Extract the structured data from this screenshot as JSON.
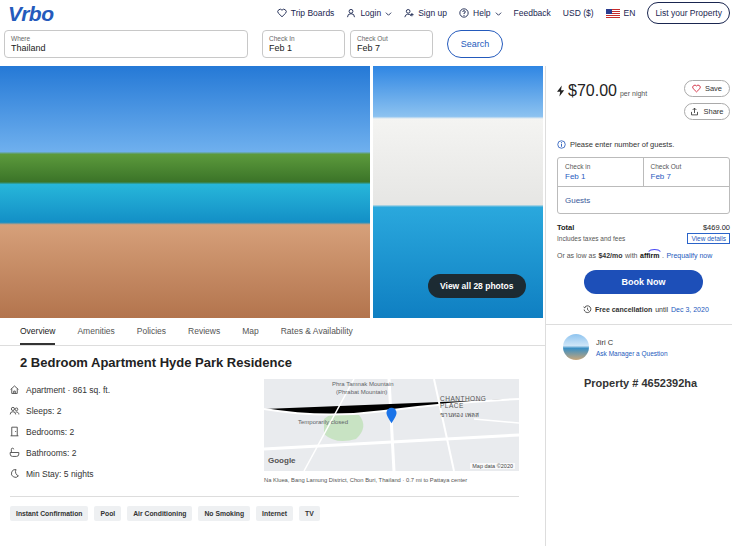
{
  "header": {
    "logo": "Vrbo",
    "nav": {
      "trip_boards": "Trip Boards",
      "login": "Login",
      "signup": "Sign up",
      "help": "Help",
      "feedback": "Feedback",
      "currency": "USD ($)",
      "language": "EN",
      "list_property": "List your Property"
    }
  },
  "search": {
    "where": {
      "label": "Where",
      "value": "Thailand"
    },
    "check_in": {
      "label": "Check In",
      "value": "Feb 1"
    },
    "check_out": {
      "label": "Check Out",
      "value": "Feb 7"
    },
    "button": "Search"
  },
  "gallery": {
    "button": "View all 28 photos"
  },
  "tabs": [
    {
      "label": "Overview",
      "selected": true
    },
    {
      "label": "Amenities",
      "selected": false
    },
    {
      "label": "Policies",
      "selected": false
    },
    {
      "label": "Reviews",
      "selected": false
    },
    {
      "label": "Map",
      "selected": false
    },
    {
      "label": "Rates & Availability",
      "selected": false
    }
  ],
  "listing": {
    "title": "2 Bedroom Apartment Hyde Park Residence",
    "facts": [
      "Apartment · 861 sq. ft.",
      "Sleeps: 2",
      "Bedrooms: 2",
      "Bathrooms: 2",
      "Min Stay: 5 nights"
    ],
    "map": {
      "poi": "Phra Tamnak Mountain",
      "poi_sub": "(Phrabat Mountain)",
      "status": "Temporarily closed",
      "district_lines": [
        "CHANTHONG",
        "PLACE"
      ],
      "district_thai": "ชานทอง เพลส",
      "brand": "Google",
      "attribution": "Map data ©2020"
    },
    "address": "Na Kluea, Bang Lamung District, Chon Buri, Thailand · 0.7 mi to Pattaya center",
    "tags": [
      "Instant Confirmation",
      "Pool",
      "Air Conditioning",
      "No Smoking",
      "Internet",
      "TV"
    ]
  },
  "sidebar": {
    "price": "$70.00",
    "per": "per night",
    "save": "Save",
    "share": "Share",
    "notice": "Please enter number of guests.",
    "booking": {
      "check_in_label": "Check in",
      "check_in": "Feb 1",
      "check_out_label": "Check Out",
      "check_out": "Feb 7",
      "guests": "Guests"
    },
    "total_label": "Total",
    "total": "$469.00",
    "taxes": "Includes taxes and fees",
    "view_details": "View details",
    "affirm": {
      "prefix": "Or as low as",
      "amount": "$42/mo",
      "mid": "with",
      "brand": "affirm",
      "suffix": ".",
      "link": "Prequalify now"
    },
    "book": "Book Now",
    "cancellation": {
      "label": "Free cancellation",
      "mid": "until",
      "date": "Dec 3, 2020"
    },
    "manager": {
      "name": "Jiri C",
      "link": "Ask Manager a Question"
    },
    "property": "Property # 4652392ha"
  }
}
